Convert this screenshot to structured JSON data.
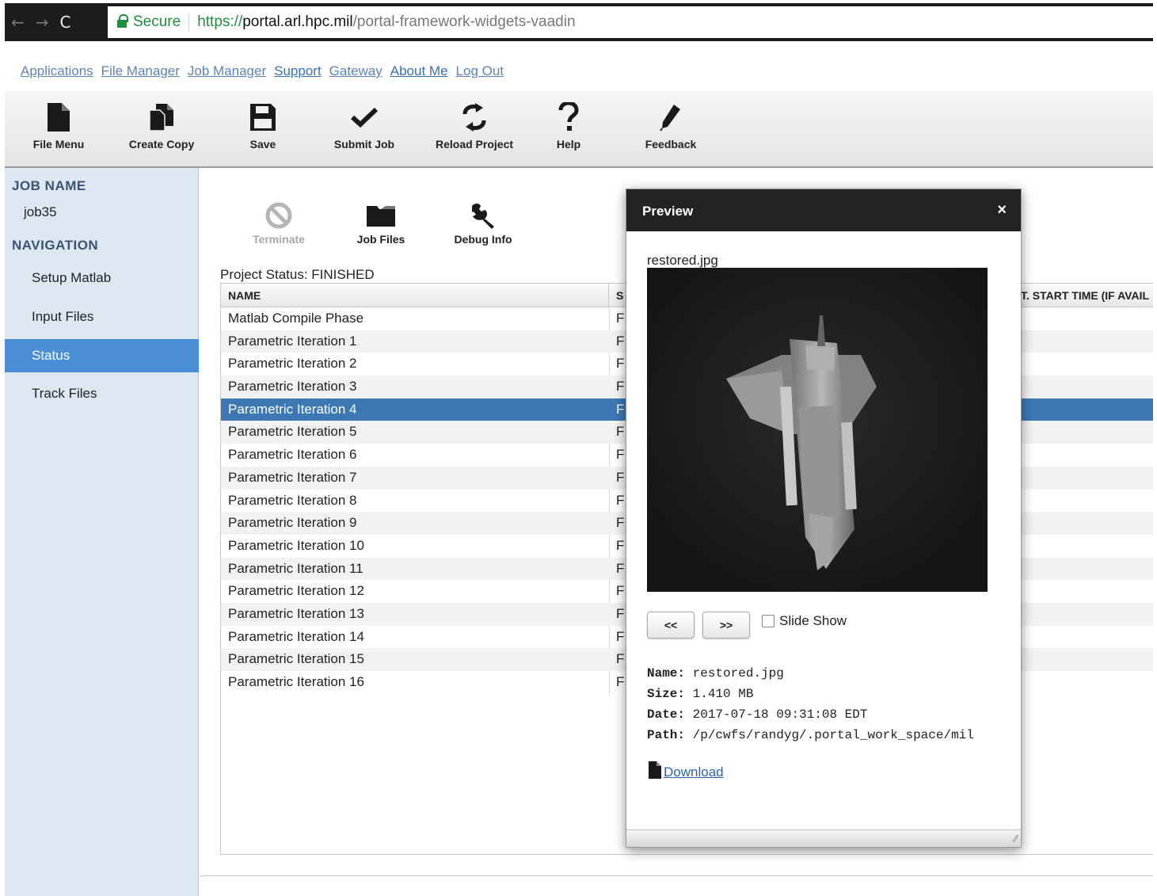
{
  "browser": {
    "back": "←",
    "forward": "→",
    "reload": "C",
    "secure_label": "Secure",
    "url_scheme": "https://",
    "url_host": "portal.arl.hpc.mil",
    "url_path": "/portal-framework-widgets-vaadin"
  },
  "top_links": [
    "Applications",
    "File Manager",
    "Job Manager",
    "Support",
    "Gateway",
    "About Me",
    "Log Out"
  ],
  "toolbar": {
    "file_menu": "File Menu",
    "create_copy": "Create Copy",
    "save": "Save",
    "submit_job": "Submit Job",
    "reload_project": "Reload Project",
    "help": "Help",
    "feedback": "Feedback"
  },
  "sidebar": {
    "job_name_heading": "JOB NAME",
    "job_name": "job35",
    "navigation_heading": "NAVIGATION",
    "items": [
      "Setup Matlab",
      "Input Files",
      "Status",
      "Track Files"
    ],
    "active_item": "Status"
  },
  "subtoolbar": {
    "terminate": "Terminate",
    "job_files": "Job Files",
    "debug_info": "Debug Info"
  },
  "project_status": "Project Status: FINISHED",
  "table": {
    "headers": {
      "name": "NAME",
      "status": "S",
      "start_time": "T. START TIME (IF AVAIL"
    },
    "rows": [
      {
        "name": "Matlab Compile Phase",
        "status": "F"
      },
      {
        "name": "Parametric Iteration 1",
        "status": "F"
      },
      {
        "name": "Parametric Iteration 2",
        "status": "F"
      },
      {
        "name": "Parametric Iteration 3",
        "status": "F"
      },
      {
        "name": "Parametric Iteration 4",
        "status": "F"
      },
      {
        "name": "Parametric Iteration 5",
        "status": "F"
      },
      {
        "name": "Parametric Iteration 6",
        "status": "F"
      },
      {
        "name": "Parametric Iteration 7",
        "status": "F"
      },
      {
        "name": "Parametric Iteration 8",
        "status": "F"
      },
      {
        "name": "Parametric Iteration 9",
        "status": "F"
      },
      {
        "name": "Parametric Iteration 10",
        "status": "F"
      },
      {
        "name": "Parametric Iteration 11",
        "status": "F"
      },
      {
        "name": "Parametric Iteration 12",
        "status": "F"
      },
      {
        "name": "Parametric Iteration 13",
        "status": "F"
      },
      {
        "name": "Parametric Iteration 14",
        "status": "F"
      },
      {
        "name": "Parametric Iteration 15",
        "status": "F"
      },
      {
        "name": "Parametric Iteration 16",
        "status": "F"
      }
    ],
    "selected_row": "Parametric Iteration 4"
  },
  "preview": {
    "title": "Preview",
    "close": "×",
    "filename": "restored.jpg",
    "prev": "<<",
    "next": ">>",
    "slideshow_label": "Slide Show",
    "info": {
      "name_label": "Name:",
      "name": "restored.jpg",
      "size_label": "Size:",
      "size": "1.410 MB",
      "date_label": "Date:",
      "date": "2017-07-18 09:31:08 EDT",
      "path_label": "Path:",
      "path": "/p/cwfs/randyg/.portal_work_space/mil"
    },
    "download": "Download"
  },
  "colors": {
    "selected_row": "#3d78b4",
    "active_nav": "#4a8ed6",
    "sidebar_bg": "#dde7f2",
    "link": "#3a6fb5",
    "secure_green": "#1e8e3e"
  }
}
